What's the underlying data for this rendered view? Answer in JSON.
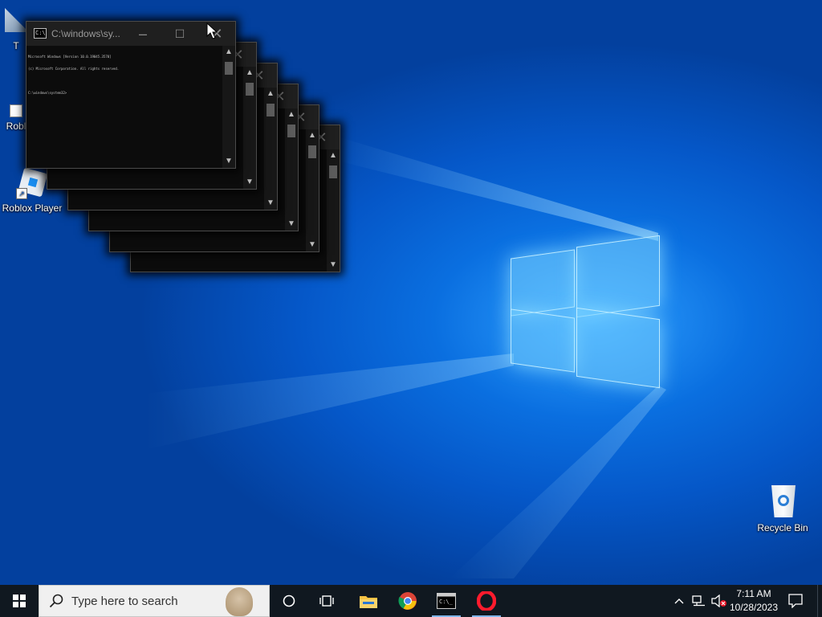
{
  "desktop": {
    "icons": [
      {
        "label": "Roblox Player",
        "icon": "roblox-icon"
      },
      {
        "label": "Recycle Bin",
        "icon": "recycle-bin-icon"
      }
    ],
    "partial_labels": [
      "Robl",
      "T"
    ]
  },
  "console": {
    "title": "C:\\windows\\sy...",
    "lines": [
      "Microsoft Windows [Version 10.0.19045.3570]",
      "(c) Microsoft Corporation. All rights reserved.",
      "",
      "C:\\windows\\system32>"
    ]
  },
  "taskbar": {
    "search_placeholder": "Type here to search",
    "clock_time": "7:11 AM",
    "clock_date": "10/28/2023",
    "apps": [
      "file-explorer-icon",
      "chrome-icon",
      "terminal-icon",
      "opera-icon"
    ]
  },
  "colors": {
    "taskbar": "#101820",
    "desktop_accent": "#0a6fe0",
    "console_bg": "#0c0c0c"
  }
}
